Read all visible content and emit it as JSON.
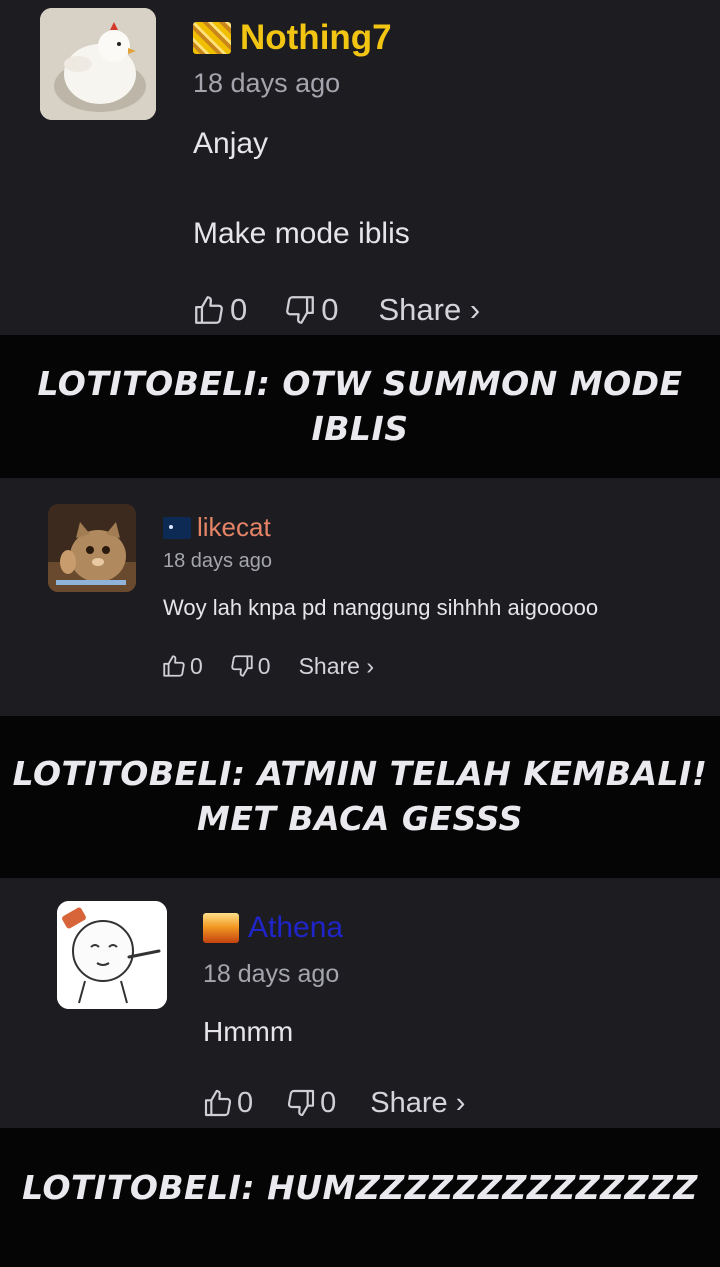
{
  "comments": [
    {
      "username": "Nothing7",
      "username_color": "#f2c513",
      "time": "18 days ago",
      "lines": [
        "Anjay",
        "Make mode iblis"
      ],
      "likes": "0",
      "dislikes": "0",
      "share_label": "Share ›",
      "avatar_icon": "chicken-avatar",
      "badge_icon": "gold-pattern-badge"
    },
    {
      "username": "likecat",
      "username_color": "#e58466",
      "time": "18 days ago",
      "lines": [
        "Woy lah knpa pd nanggung sihhhh aigooooo"
      ],
      "likes": "0",
      "dislikes": "0",
      "share_label": "Share ›",
      "avatar_icon": "cat-avatar",
      "badge_icon": "space-badge"
    },
    {
      "username": "Athena",
      "username_color": "#1f25c9",
      "time": "18 days ago",
      "lines": [
        "Hmmm"
      ],
      "likes": "0",
      "dislikes": "0",
      "share_label": "Share ›",
      "avatar_icon": "meme-face-avatar",
      "badge_icon": "fire-badge"
    }
  ],
  "banners": [
    {
      "lines": [
        "LOTITOBELI: OTW SUMMON MODE IBLIS"
      ]
    },
    {
      "lines": [
        "LOTITOBELI: ATMIN TELAH KEMBALI!",
        "MET BACA GESSS"
      ]
    },
    {
      "lines": [
        "LOTITOBELI: HUMZZZZZZZZZZZZZZ"
      ]
    }
  ]
}
